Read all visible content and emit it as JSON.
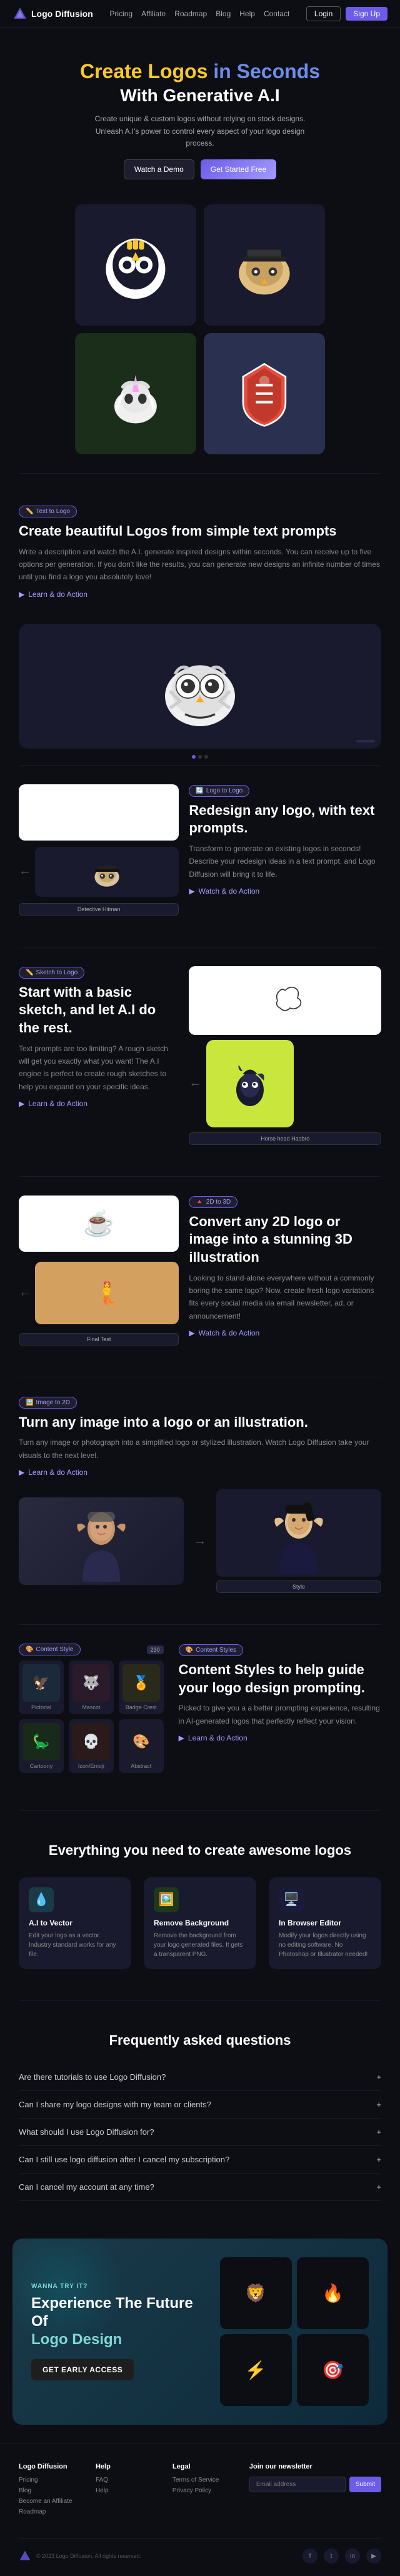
{
  "site": {
    "name": "Logo Diffusion"
  },
  "navbar": {
    "logo_text": "Logo Diffusion",
    "links": [
      "Pricing",
      "Affiliate",
      "Roadmap",
      "Blog",
      "Help",
      "Contact"
    ],
    "login_label": "Login",
    "signup_label": "Sign Up"
  },
  "hero": {
    "line1_part1": "Create Logos",
    "line1_part2": "in Seconds",
    "line2": "With Generative A.I",
    "subtitle": "Create unique & custom logos without relying on stock designs. Unleash A.I's power to control every aspect of your logo design process.",
    "btn_watch": "Watch a Demo",
    "btn_started": "Get Started Free"
  },
  "feature_ttl": {
    "badge": "Text to Logo",
    "title": "Create beautiful Logos from\nsimple text prompts",
    "desc": "Write a description and watch the A.I. generate inspired designs within seconds. You can receive up to five options per generation. If you don't like the results, you can generate new designs an infinite number of times until you find a logo you absolutely love!",
    "learn_more": "Learn & do Action"
  },
  "feature_ltl": {
    "badge": "Logo to Logo",
    "title": "Redesign any logo, with text\nprompts.",
    "desc": "Transform to generate on existing logos in seconds! Describe your redesign ideas in a text prompt, and Logo Diffusion will bring it to life.",
    "learn_more": "Watch & do Action",
    "card_label": "Detective Hitman"
  },
  "feature_sketch": {
    "badge": "Sketch to Logo",
    "title": "Start with a basic sketch, and let A.I do the rest.",
    "desc": "Text prompts are too limiting? A rough sketch will get you exactly what you want! The A.I engine is perfect to create rough sketches to help you expand on your specific ideas.",
    "learn_more": "Learn & do Action",
    "card_label": "Horse head Hasbro"
  },
  "feature_3d": {
    "badge": "2D to 3D",
    "title": "Convert any 2D logo or image\ninto a stunning 3D illustration",
    "desc": "Looking to stand-alone everywhere without a commonly boring the same logo? Now, create fresh logo variations fits every social media via email newsletter, ad, or announcement!",
    "learn_more": "Watch & do Action",
    "card_label": "Final Test"
  },
  "feature_img": {
    "badge": "Image to 2D",
    "title": "Turn any image into a logo or an illustration.",
    "desc": "Turn any image or photograph into a simplified logo or stylized illustration. Watch Logo Diffusion take your visuals to the next level.",
    "learn_more": "Learn & do Action",
    "card_label": "Style"
  },
  "content_styles": {
    "badge": "Content Style",
    "count": "230",
    "items": [
      {
        "emoji": "🦅",
        "label": "Pictorial"
      },
      {
        "emoji": "🐺",
        "label": "Mascot"
      },
      {
        "emoji": "🏅",
        "label": "Badge Crest"
      },
      {
        "emoji": "🦕",
        "label": "Cartoony"
      },
      {
        "emoji": "💀",
        "label": "Icon/Emoji"
      },
      {
        "emoji": "🎨",
        "label": "Abstract"
      }
    ],
    "right_badge": "Content Styles",
    "right_title": "Content Styles to help guide your logo design prompting.",
    "right_desc": "Picked to give you a a better prompting experience, resulting in AI-generated logos that perfectly reflect your vision.",
    "learn_more": "Learn & do Action"
  },
  "everything": {
    "title": "Everything you need to create\nawesome logos",
    "features": [
      {
        "icon": "💧",
        "icon_bg": "#1a3a4a",
        "title": "A.I to Vector",
        "desc": "Edit your logo as a vector. Industry standard works for any file."
      },
      {
        "icon": "🖼️",
        "icon_bg": "#1a3a1a",
        "title": "Remove Background",
        "desc": "Remove the background from your logo generated files. It gets a transparent PNG."
      },
      {
        "icon": "🖥️",
        "icon_bg": "#1a1a3a",
        "title": "In Browser Editor",
        "desc": "Modify your logos directly using no editing software. No Photoshop or Illustrator needed!"
      }
    ]
  },
  "faq": {
    "title": "Frequently asked questions",
    "items": [
      {
        "question": "Are there tutorials to use Logo Diffusion?"
      },
      {
        "question": "Can I share my logo designs with my team or clients?"
      },
      {
        "question": "What should I use Logo Diffusion for?"
      },
      {
        "question": "Can I still use logo diffusion after I cancel my subscription?"
      },
      {
        "question": "Can I cancel my account at any time?"
      }
    ]
  },
  "cta": {
    "eyebrow": "WANNA TRY IT?",
    "title_line1": "Experience The Future Of",
    "title_line2": "Logo Design",
    "btn_label": "GET EARLY ACCESS",
    "logos": [
      "🦁",
      "🔥",
      "⚡",
      "🎯"
    ]
  },
  "footer": {
    "col1_title": "Logo Diffusion",
    "col1_links": [
      "Pricing",
      "Blog",
      "Become an Affiliate",
      "Roadmap"
    ],
    "col2_title": "Help",
    "col2_links": [
      "FAQ",
      "Help"
    ],
    "col3_title": "Legal",
    "col3_links": [
      "Terms of Service",
      "Privacy Policy"
    ],
    "col4_title": "Join our newsletter",
    "newsletter_placeholder": "Email address",
    "newsletter_btn": "Submit",
    "copyright": "© 2023 Logo Diffusion. All rights reserved.",
    "social_icons": [
      "f",
      "t",
      "in",
      "yt"
    ]
  }
}
